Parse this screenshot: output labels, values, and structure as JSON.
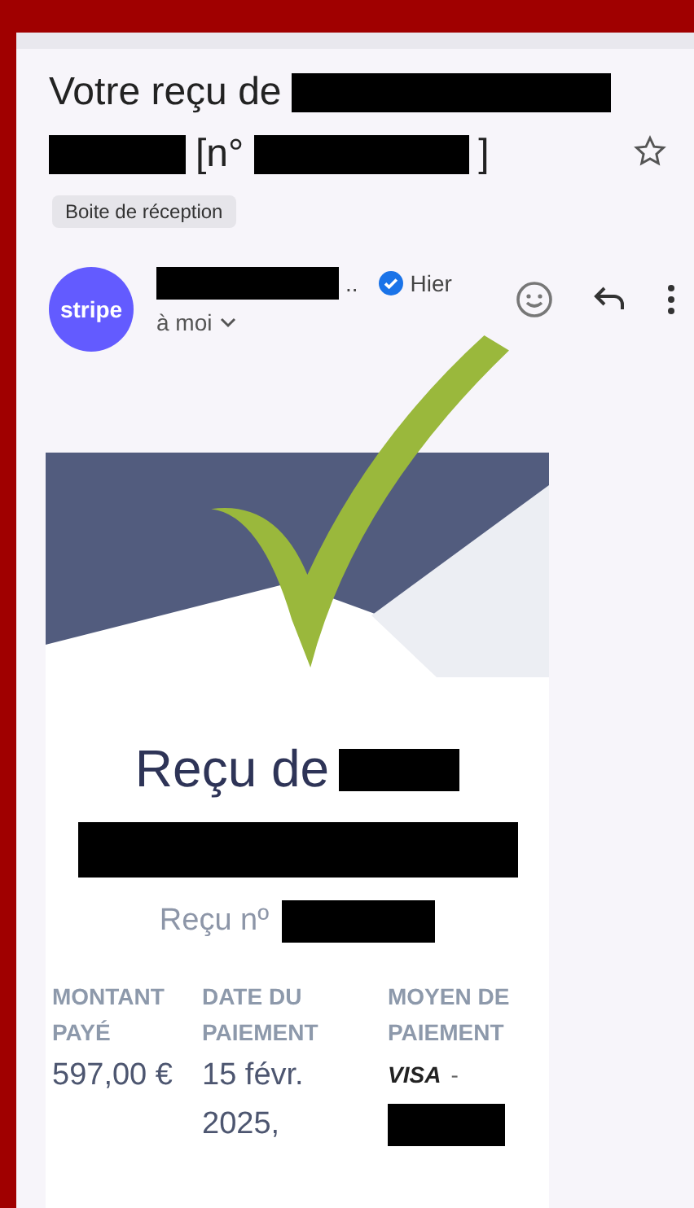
{
  "subject": {
    "lines": [
      [
        {
          "kind": "text",
          "text": "Votre reçu de"
        },
        {
          "kind": "redacted"
        }
      ],
      [
        {
          "kind": "redacted"
        },
        {
          "kind": "text",
          "text": "[n°"
        },
        {
          "kind": "redacted"
        },
        {
          "kind": "text",
          "text": "]"
        }
      ]
    ],
    "starred": false
  },
  "label": "Boite de réception",
  "sender": {
    "avatar": "stripe",
    "verified": true,
    "ellipsis": "..",
    "time": "Hier",
    "recipient": "à moi"
  },
  "receipt": {
    "title": "Reçu de",
    "number_label": "Reçu nº",
    "columns": [
      {
        "heading": "MONTANT PAYÉ",
        "lines": [
          "597,00 €"
        ]
      },
      {
        "heading": "DATE DU PAIEMENT",
        "lines": [
          "15 févr.",
          "2025,"
        ]
      },
      {
        "heading": "MOYEN DE PAIEMENT",
        "card_brand": "VISA",
        "separator": "-"
      }
    ]
  }
}
